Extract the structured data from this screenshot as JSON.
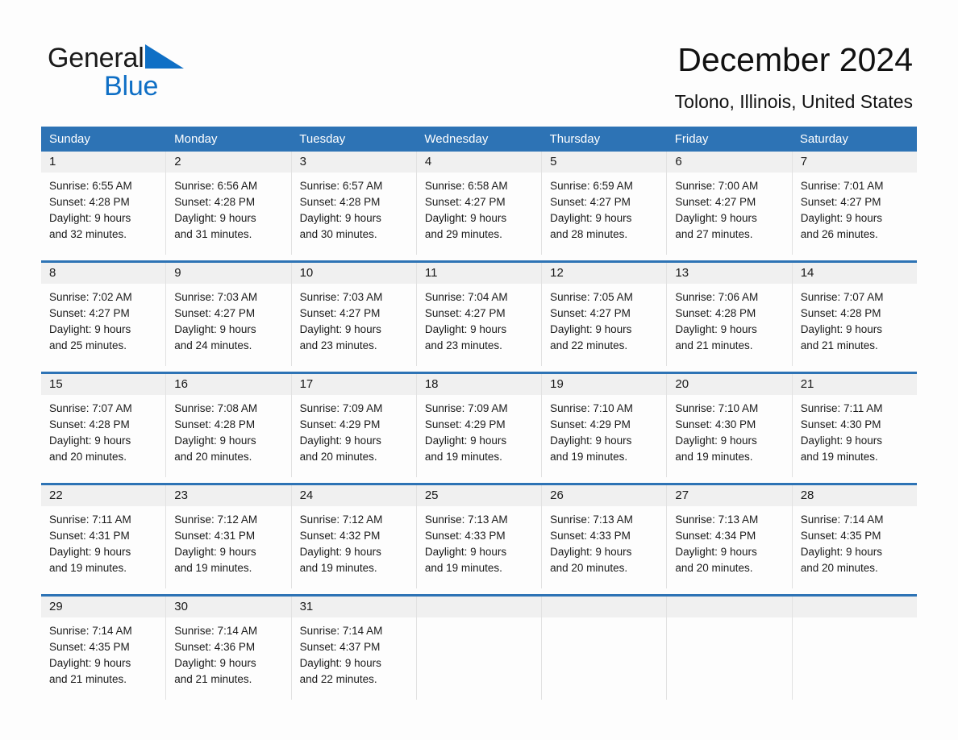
{
  "brand": {
    "name_part1": "General",
    "name_part2": "Blue",
    "accent_color": "#0f6fc5"
  },
  "header": {
    "title": "December 2024",
    "location": "Tolono, Illinois, United States",
    "header_bg_color": "#2d73b5",
    "day_band_color": "#f0f0f0"
  },
  "weekday_headers": [
    "Sunday",
    "Monday",
    "Tuesday",
    "Wednesday",
    "Thursday",
    "Friday",
    "Saturday"
  ],
  "weeks": [
    [
      {
        "day": "1",
        "sunrise": "Sunrise: 6:55 AM",
        "sunset": "Sunset: 4:28 PM",
        "daylight_line1": "Daylight: 9 hours",
        "daylight_line2": "and 32 minutes."
      },
      {
        "day": "2",
        "sunrise": "Sunrise: 6:56 AM",
        "sunset": "Sunset: 4:28 PM",
        "daylight_line1": "Daylight: 9 hours",
        "daylight_line2": "and 31 minutes."
      },
      {
        "day": "3",
        "sunrise": "Sunrise: 6:57 AM",
        "sunset": "Sunset: 4:28 PM",
        "daylight_line1": "Daylight: 9 hours",
        "daylight_line2": "and 30 minutes."
      },
      {
        "day": "4",
        "sunrise": "Sunrise: 6:58 AM",
        "sunset": "Sunset: 4:27 PM",
        "daylight_line1": "Daylight: 9 hours",
        "daylight_line2": "and 29 minutes."
      },
      {
        "day": "5",
        "sunrise": "Sunrise: 6:59 AM",
        "sunset": "Sunset: 4:27 PM",
        "daylight_line1": "Daylight: 9 hours",
        "daylight_line2": "and 28 minutes."
      },
      {
        "day": "6",
        "sunrise": "Sunrise: 7:00 AM",
        "sunset": "Sunset: 4:27 PM",
        "daylight_line1": "Daylight: 9 hours",
        "daylight_line2": "and 27 minutes."
      },
      {
        "day": "7",
        "sunrise": "Sunrise: 7:01 AM",
        "sunset": "Sunset: 4:27 PM",
        "daylight_line1": "Daylight: 9 hours",
        "daylight_line2": "and 26 minutes."
      }
    ],
    [
      {
        "day": "8",
        "sunrise": "Sunrise: 7:02 AM",
        "sunset": "Sunset: 4:27 PM",
        "daylight_line1": "Daylight: 9 hours",
        "daylight_line2": "and 25 minutes."
      },
      {
        "day": "9",
        "sunrise": "Sunrise: 7:03 AM",
        "sunset": "Sunset: 4:27 PM",
        "daylight_line1": "Daylight: 9 hours",
        "daylight_line2": "and 24 minutes."
      },
      {
        "day": "10",
        "sunrise": "Sunrise: 7:03 AM",
        "sunset": "Sunset: 4:27 PM",
        "daylight_line1": "Daylight: 9 hours",
        "daylight_line2": "and 23 minutes."
      },
      {
        "day": "11",
        "sunrise": "Sunrise: 7:04 AM",
        "sunset": "Sunset: 4:27 PM",
        "daylight_line1": "Daylight: 9 hours",
        "daylight_line2": "and 23 minutes."
      },
      {
        "day": "12",
        "sunrise": "Sunrise: 7:05 AM",
        "sunset": "Sunset: 4:27 PM",
        "daylight_line1": "Daylight: 9 hours",
        "daylight_line2": "and 22 minutes."
      },
      {
        "day": "13",
        "sunrise": "Sunrise: 7:06 AM",
        "sunset": "Sunset: 4:28 PM",
        "daylight_line1": "Daylight: 9 hours",
        "daylight_line2": "and 21 minutes."
      },
      {
        "day": "14",
        "sunrise": "Sunrise: 7:07 AM",
        "sunset": "Sunset: 4:28 PM",
        "daylight_line1": "Daylight: 9 hours",
        "daylight_line2": "and 21 minutes."
      }
    ],
    [
      {
        "day": "15",
        "sunrise": "Sunrise: 7:07 AM",
        "sunset": "Sunset: 4:28 PM",
        "daylight_line1": "Daylight: 9 hours",
        "daylight_line2": "and 20 minutes."
      },
      {
        "day": "16",
        "sunrise": "Sunrise: 7:08 AM",
        "sunset": "Sunset: 4:28 PM",
        "daylight_line1": "Daylight: 9 hours",
        "daylight_line2": "and 20 minutes."
      },
      {
        "day": "17",
        "sunrise": "Sunrise: 7:09 AM",
        "sunset": "Sunset: 4:29 PM",
        "daylight_line1": "Daylight: 9 hours",
        "daylight_line2": "and 20 minutes."
      },
      {
        "day": "18",
        "sunrise": "Sunrise: 7:09 AM",
        "sunset": "Sunset: 4:29 PM",
        "daylight_line1": "Daylight: 9 hours",
        "daylight_line2": "and 19 minutes."
      },
      {
        "day": "19",
        "sunrise": "Sunrise: 7:10 AM",
        "sunset": "Sunset: 4:29 PM",
        "daylight_line1": "Daylight: 9 hours",
        "daylight_line2": "and 19 minutes."
      },
      {
        "day": "20",
        "sunrise": "Sunrise: 7:10 AM",
        "sunset": "Sunset: 4:30 PM",
        "daylight_line1": "Daylight: 9 hours",
        "daylight_line2": "and 19 minutes."
      },
      {
        "day": "21",
        "sunrise": "Sunrise: 7:11 AM",
        "sunset": "Sunset: 4:30 PM",
        "daylight_line1": "Daylight: 9 hours",
        "daylight_line2": "and 19 minutes."
      }
    ],
    [
      {
        "day": "22",
        "sunrise": "Sunrise: 7:11 AM",
        "sunset": "Sunset: 4:31 PM",
        "daylight_line1": "Daylight: 9 hours",
        "daylight_line2": "and 19 minutes."
      },
      {
        "day": "23",
        "sunrise": "Sunrise: 7:12 AM",
        "sunset": "Sunset: 4:31 PM",
        "daylight_line1": "Daylight: 9 hours",
        "daylight_line2": "and 19 minutes."
      },
      {
        "day": "24",
        "sunrise": "Sunrise: 7:12 AM",
        "sunset": "Sunset: 4:32 PM",
        "daylight_line1": "Daylight: 9 hours",
        "daylight_line2": "and 19 minutes."
      },
      {
        "day": "25",
        "sunrise": "Sunrise: 7:13 AM",
        "sunset": "Sunset: 4:33 PM",
        "daylight_line1": "Daylight: 9 hours",
        "daylight_line2": "and 19 minutes."
      },
      {
        "day": "26",
        "sunrise": "Sunrise: 7:13 AM",
        "sunset": "Sunset: 4:33 PM",
        "daylight_line1": "Daylight: 9 hours",
        "daylight_line2": "and 20 minutes."
      },
      {
        "day": "27",
        "sunrise": "Sunrise: 7:13 AM",
        "sunset": "Sunset: 4:34 PM",
        "daylight_line1": "Daylight: 9 hours",
        "daylight_line2": "and 20 minutes."
      },
      {
        "day": "28",
        "sunrise": "Sunrise: 7:14 AM",
        "sunset": "Sunset: 4:35 PM",
        "daylight_line1": "Daylight: 9 hours",
        "daylight_line2": "and 20 minutes."
      }
    ],
    [
      {
        "day": "29",
        "sunrise": "Sunrise: 7:14 AM",
        "sunset": "Sunset: 4:35 PM",
        "daylight_line1": "Daylight: 9 hours",
        "daylight_line2": "and 21 minutes."
      },
      {
        "day": "30",
        "sunrise": "Sunrise: 7:14 AM",
        "sunset": "Sunset: 4:36 PM",
        "daylight_line1": "Daylight: 9 hours",
        "daylight_line2": "and 21 minutes."
      },
      {
        "day": "31",
        "sunrise": "Sunrise: 7:14 AM",
        "sunset": "Sunset: 4:37 PM",
        "daylight_line1": "Daylight: 9 hours",
        "daylight_line2": "and 22 minutes."
      },
      {
        "day": "",
        "sunrise": "",
        "sunset": "",
        "daylight_line1": "",
        "daylight_line2": ""
      },
      {
        "day": "",
        "sunrise": "",
        "sunset": "",
        "daylight_line1": "",
        "daylight_line2": ""
      },
      {
        "day": "",
        "sunrise": "",
        "sunset": "",
        "daylight_line1": "",
        "daylight_line2": ""
      },
      {
        "day": "",
        "sunrise": "",
        "sunset": "",
        "daylight_line1": "",
        "daylight_line2": ""
      }
    ]
  ]
}
